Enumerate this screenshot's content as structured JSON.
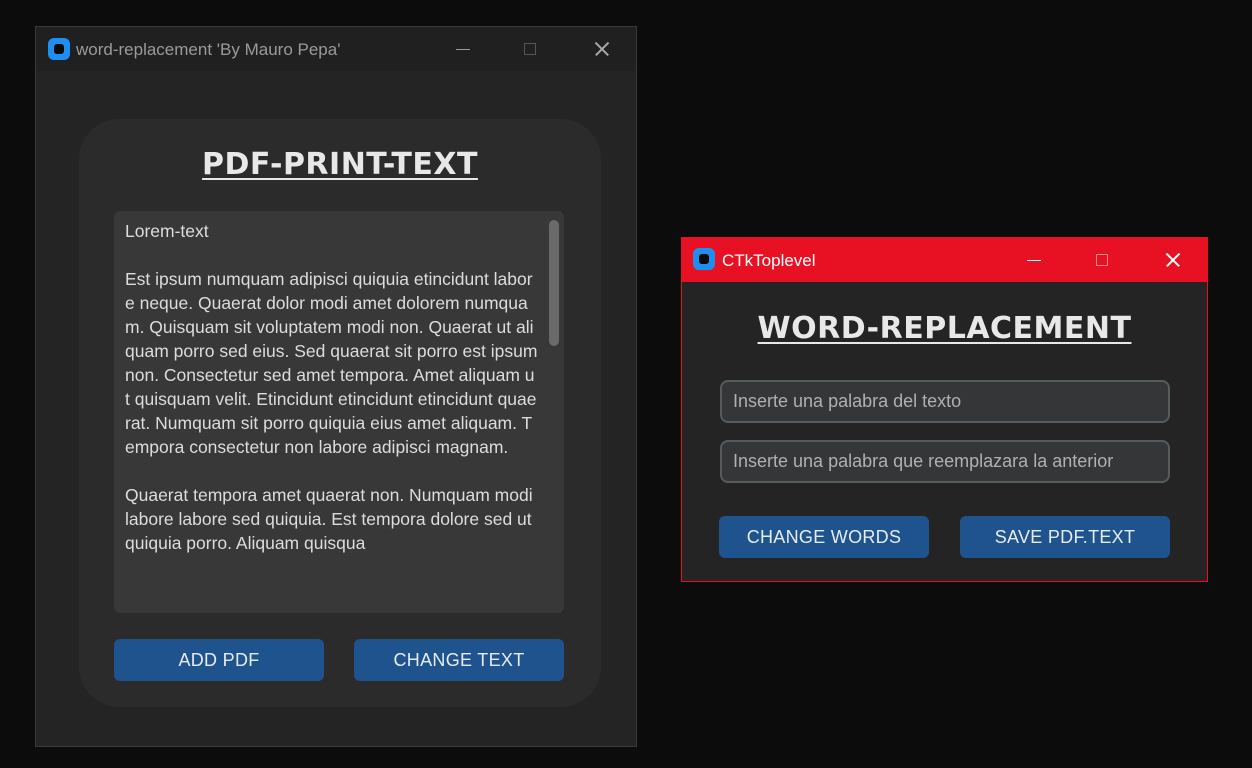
{
  "main_window": {
    "title": "word-replacement 'By Mauro Pepa'",
    "heading": "PDF-PRINT-TEXT",
    "text_content": "Lorem-text\n\nEst ipsum numquam adipisci quiquia etincidunt labore neque. Quaerat dolor modi amet dolorem numquam. Quisquam sit voluptatem modi non. Quaerat ut aliquam porro sed eius. Sed quaerat sit porro est ipsum non. Consectetur sed amet tempora. Amet aliquam ut quisquam velit. Etincidunt etincidunt etincidunt quaerat. Numquam sit porro quiquia eius amet aliquam. Tempora consectetur non labore adipisci magnam.\n\nQuaerat tempora amet quaerat non. Numquam modi labore labore sed quiquia. Est tempora dolore sed ut quiquia porro. Aliquam quisqua",
    "buttons": {
      "add_pdf": "ADD PDF",
      "change_text": "CHANGE TEXT"
    }
  },
  "popup_window": {
    "title": "CTkToplevel",
    "heading": "WORD-REPLACEMENT",
    "word_placeholder": "Inserte una palabra del texto",
    "replace_placeholder": "Inserte una palabra que reemplazara la anterior",
    "buttons": {
      "change_words": "CHANGE WORDS",
      "save_pdf_text": "SAVE PDF.TEXT"
    }
  },
  "colors": {
    "button": "#1f538d",
    "popup_titlebar": "#e81123",
    "background": "#0c0c0c"
  },
  "icons": [
    "app-icon",
    "minimize-icon",
    "maximize-icon",
    "close-icon"
  ]
}
